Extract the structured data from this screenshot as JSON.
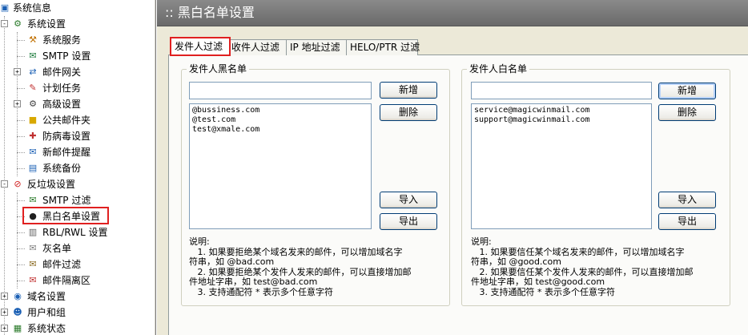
{
  "tree": {
    "items": [
      {
        "label": "系统信息",
        "icon": "monitor-icon"
      },
      {
        "label": "系统设置",
        "icon": "settings-folder-icon",
        "expander": "-"
      },
      {
        "label": "系统服务",
        "icon": "service-icon"
      },
      {
        "label": "SMTP 设置",
        "icon": "smtp-icon"
      },
      {
        "label": "邮件网关",
        "icon": "gateway-icon",
        "expander": "+"
      },
      {
        "label": "计划任务",
        "icon": "schedule-icon"
      },
      {
        "label": "高级设置",
        "icon": "advanced-icon",
        "expander": "+"
      },
      {
        "label": "公共邮件夹",
        "icon": "folder-icon"
      },
      {
        "label": "防病毒设置",
        "icon": "antivirus-icon"
      },
      {
        "label": "新邮件提醒",
        "icon": "notify-icon"
      },
      {
        "label": "系统备份",
        "icon": "backup-icon"
      },
      {
        "label": "反垃圾设置",
        "icon": "antispam-icon",
        "expander": "-"
      },
      {
        "label": "SMTP 过滤",
        "icon": "filter-icon"
      },
      {
        "label": "黑白名单设置",
        "icon": "person-icon"
      },
      {
        "label": "RBL/RWL 设置",
        "icon": "rbl-icon"
      },
      {
        "label": "灰名单",
        "icon": "greylist-icon"
      },
      {
        "label": "邮件过滤",
        "icon": "mailfilter-icon"
      },
      {
        "label": "邮件隔离区",
        "icon": "quarantine-icon"
      },
      {
        "label": "域名设置",
        "icon": "domain-icon",
        "expander": "+"
      },
      {
        "label": "用户和组",
        "icon": "users-icon",
        "expander": "+"
      },
      {
        "label": "系统状态",
        "icon": "status-icon",
        "expander": "+"
      }
    ]
  },
  "header": {
    "title": ":: 黑白名单设置"
  },
  "tabs": [
    {
      "label": "发件人过滤",
      "active": true
    },
    {
      "label": "收件人过滤"
    },
    {
      "label": "IP 地址过滤"
    },
    {
      "label": "HELO/PTR 过滤"
    }
  ],
  "blacklist": {
    "title": "发件人黑名单",
    "input_value": "",
    "entries": [
      "@bussiness.com",
      "@test.com",
      "test@xmale.com"
    ],
    "add_label": "新增",
    "delete_label": "删除",
    "import_label": "导入",
    "export_label": "导出",
    "notes": "说明:\n   1. 如果要拒绝某个域名发来的邮件，可以增加域名字\n符串，如 @bad.com\n   2. 如果要拒绝某个发件人发来的邮件，可以直接增加邮\n件地址字串，如 test@bad.com\n   3. 支持通配符 * 表示多个任意字符"
  },
  "whitelist": {
    "title": "发件人白名单",
    "input_value": "",
    "entries": [
      "service@magicwinmail.com",
      "support@magicwinmail.com"
    ],
    "add_label": "新增",
    "delete_label": "删除",
    "import_label": "导入",
    "export_label": "导出",
    "notes": "说明:\n   1. 如果要信任某个域名发来的邮件，可以增加域名字\n符串，如 @good.com\n   2. 如果要信任某个发件人发来的邮件，可以直接增加邮\n件地址字串，如 test@good.com\n   3. 支持通配符 * 表示多个任意字符"
  }
}
